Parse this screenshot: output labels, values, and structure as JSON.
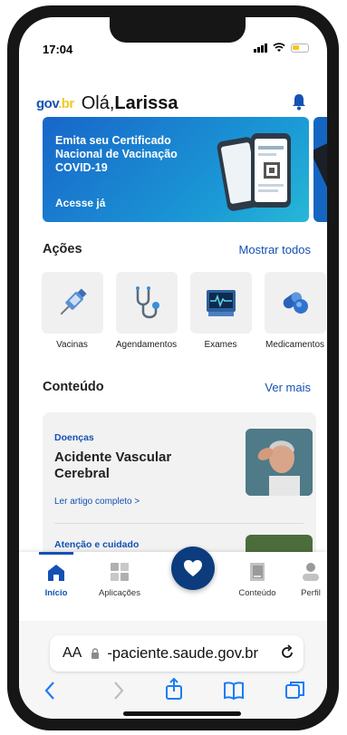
{
  "status": {
    "time": "17:04"
  },
  "header": {
    "logo_gov": "gov",
    "logo_br": ".br",
    "greeting_prefix": "Olá,",
    "user_name": "Larissa"
  },
  "banner": {
    "text": "Emita seu Certificado Nacional de Vacinação COVID-19",
    "cta": "Acesse já"
  },
  "actions": {
    "title": "Ações",
    "show_all": "Mostrar todos",
    "items": [
      {
        "label": "Vacinas",
        "icon": "vaccine-icon"
      },
      {
        "label": "Agendamentos",
        "icon": "stethoscope-icon"
      },
      {
        "label": "Exames",
        "icon": "monitor-icon"
      },
      {
        "label": "Medicamentos",
        "icon": "pills-icon"
      }
    ]
  },
  "content": {
    "title": "Conteúdo",
    "see_more": "Ver mais",
    "card1": {
      "category": "Doenças",
      "title": "Acidente Vascular Cerebral",
      "link": "Ler artigo completo  >"
    },
    "card2": {
      "category": "Atenção e cuidado"
    }
  },
  "tabs": [
    {
      "label": "Início",
      "active": true
    },
    {
      "label": "Aplicações"
    },
    {
      "label": "Conteúdo"
    },
    {
      "label": "Perfil"
    }
  ],
  "browser": {
    "aa": "AA",
    "url": "-paciente.saude.gov.br"
  },
  "colors": {
    "primary": "#1351b4",
    "dark_blue": "#0c3c7d",
    "logo_yellow": "#f3c825",
    "logo_green": "#168821"
  }
}
